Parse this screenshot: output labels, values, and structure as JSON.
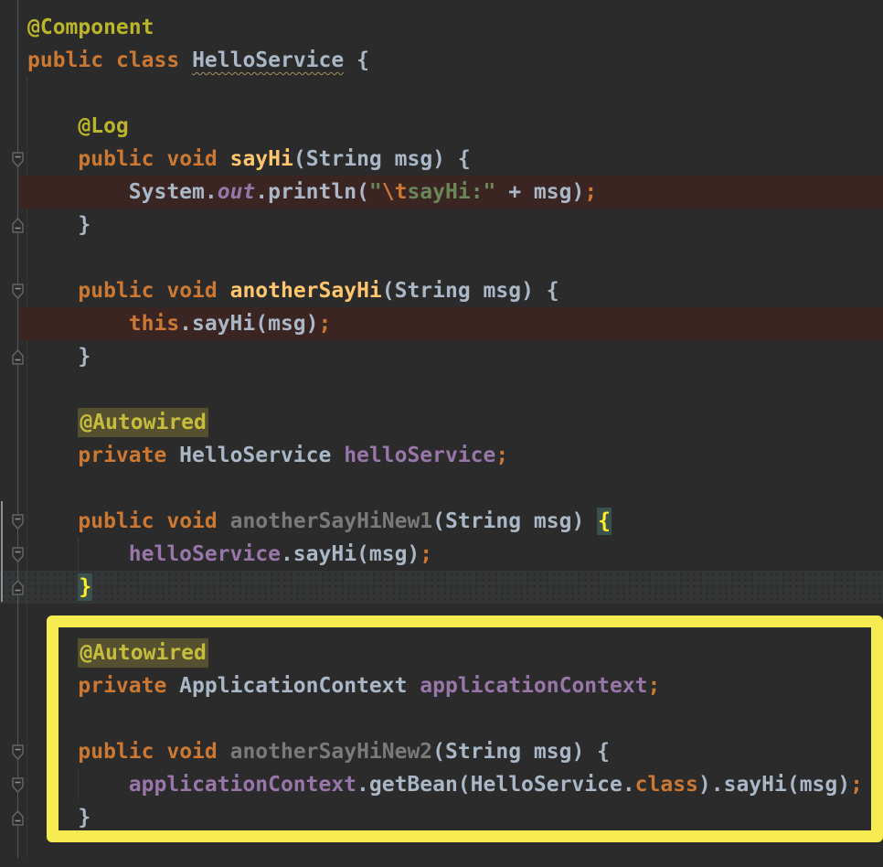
{
  "app": {
    "name": "IntelliJ-style Java code editor",
    "theme": "dark"
  },
  "colors": {
    "editor_background": "#2B2B2B",
    "execution_line_background": "#3A2523",
    "caret_line_background": "#343536",
    "annotation_box_yellow": "#F6EC52",
    "occurrence_highlight": "#555130",
    "matched_brace": "#FFEF28",
    "keyword": "#CC7832",
    "annotation_text": "#BBB529",
    "method_declaration": "#FFC66D",
    "unused_method": "#7A7A7A",
    "default_text": "#A9B7C6",
    "field": "#9876AA",
    "string": "#6A8759"
  },
  "editor": {
    "caret_line": 18,
    "lines": [
      {
        "bg": null,
        "tokens": [
          [
            "a",
            "@Component"
          ]
        ]
      },
      {
        "bg": null,
        "tokens": [
          [
            "k",
            "public"
          ],
          [
            "d",
            " "
          ],
          [
            "k",
            "class"
          ],
          [
            "d",
            " "
          ],
          [
            "w",
            "HelloService"
          ],
          [
            "d",
            " {"
          ]
        ]
      },
      {
        "bg": null,
        "tokens": []
      },
      {
        "bg": null,
        "tokens": [
          [
            "d",
            "    "
          ],
          [
            "a",
            "@Log"
          ]
        ]
      },
      {
        "bg": null,
        "tokens": [
          [
            "d",
            "    "
          ],
          [
            "k",
            "public"
          ],
          [
            "d",
            " "
          ],
          [
            "k",
            "void"
          ],
          [
            "d",
            " "
          ],
          [
            "m",
            "sayHi"
          ],
          [
            "d",
            "(String msg) {"
          ]
        ]
      },
      {
        "bg": "exec",
        "tokens": [
          [
            "d",
            "        System."
          ],
          [
            "fi",
            "out"
          ],
          [
            "d",
            ".println("
          ],
          [
            "s",
            "\""
          ],
          [
            "e",
            "\\t"
          ],
          [
            "s",
            "sayHi:\""
          ],
          [
            "d",
            " + msg)"
          ],
          [
            "k",
            ";"
          ]
        ]
      },
      {
        "bg": null,
        "tokens": [
          [
            "d",
            "    }"
          ]
        ]
      },
      {
        "bg": null,
        "tokens": []
      },
      {
        "bg": null,
        "tokens": [
          [
            "d",
            "    "
          ],
          [
            "k",
            "public"
          ],
          [
            "d",
            " "
          ],
          [
            "k",
            "void"
          ],
          [
            "d",
            " "
          ],
          [
            "m",
            "anotherSayHi"
          ],
          [
            "d",
            "(String msg) {"
          ]
        ]
      },
      {
        "bg": "exec",
        "tokens": [
          [
            "d",
            "        "
          ],
          [
            "k",
            "this"
          ],
          [
            "d",
            ".sayHi(msg)"
          ],
          [
            "k",
            ";"
          ]
        ]
      },
      {
        "bg": null,
        "tokens": [
          [
            "d",
            "    }"
          ]
        ]
      },
      {
        "bg": null,
        "tokens": []
      },
      {
        "bg": null,
        "tokens": [
          [
            "d",
            "    "
          ],
          [
            "hl",
            "@Autowired"
          ]
        ]
      },
      {
        "bg": null,
        "tokens": [
          [
            "d",
            "    "
          ],
          [
            "k",
            "private"
          ],
          [
            "d",
            " HelloService "
          ],
          [
            "f",
            "helloService"
          ],
          [
            "k",
            ";"
          ]
        ]
      },
      {
        "bg": null,
        "tokens": []
      },
      {
        "bg": null,
        "tokens": [
          [
            "d",
            "    "
          ],
          [
            "k",
            "public"
          ],
          [
            "d",
            " "
          ],
          [
            "k",
            "void"
          ],
          [
            "d",
            " "
          ],
          [
            "g",
            "anotherSayHiNew1"
          ],
          [
            "d",
            "(String msg) "
          ],
          [
            "br",
            "{"
          ]
        ]
      },
      {
        "bg": null,
        "tokens": [
          [
            "d",
            "        "
          ],
          [
            "f",
            "helloService"
          ],
          [
            "d",
            ".sayHi(msg)"
          ],
          [
            "k",
            ";"
          ]
        ]
      },
      {
        "bg": null,
        "tokens": [
          [
            "d",
            "    "
          ],
          [
            "br",
            "}"
          ]
        ]
      },
      {
        "bg": null,
        "tokens": []
      },
      {
        "bg": null,
        "tokens": [
          [
            "d",
            "    "
          ],
          [
            "hl",
            "@Autowired"
          ]
        ]
      },
      {
        "bg": null,
        "tokens": [
          [
            "d",
            "    "
          ],
          [
            "k",
            "private"
          ],
          [
            "d",
            " ApplicationContext "
          ],
          [
            "f",
            "applicationContext"
          ],
          [
            "k",
            ";"
          ]
        ]
      },
      {
        "bg": null,
        "tokens": []
      },
      {
        "bg": null,
        "tokens": [
          [
            "d",
            "    "
          ],
          [
            "k",
            "public"
          ],
          [
            "d",
            " "
          ],
          [
            "k",
            "void"
          ],
          [
            "d",
            " "
          ],
          [
            "g",
            "anotherSayHiNew2"
          ],
          [
            "d",
            "(String msg) {"
          ]
        ]
      },
      {
        "bg": null,
        "tokens": [
          [
            "d",
            "        "
          ],
          [
            "f",
            "applicationContext"
          ],
          [
            "d",
            ".getBean(HelloService."
          ],
          [
            "k",
            "class"
          ],
          [
            "d",
            ").sayHi(msg)"
          ],
          [
            "k",
            ";"
          ]
        ]
      },
      {
        "bg": null,
        "tokens": [
          [
            "d",
            "    }"
          ]
        ]
      },
      {
        "bg": null,
        "tokens": []
      }
    ],
    "fold_markers": [
      {
        "line": 5,
        "dir": "down"
      },
      {
        "line": 7,
        "dir": "up"
      },
      {
        "line": 9,
        "dir": "down"
      },
      {
        "line": 11,
        "dir": "up"
      },
      {
        "line": 16,
        "dir": "down"
      },
      {
        "line": 17,
        "dir": "down"
      },
      {
        "line": 18,
        "dir": "up"
      },
      {
        "line": 23,
        "dir": "down"
      },
      {
        "line": 24,
        "dir": "down"
      },
      {
        "line": 25,
        "dir": "up"
      }
    ],
    "annotation_box": {
      "purpose": "highlights the @Autowired ApplicationContext block"
    }
  }
}
